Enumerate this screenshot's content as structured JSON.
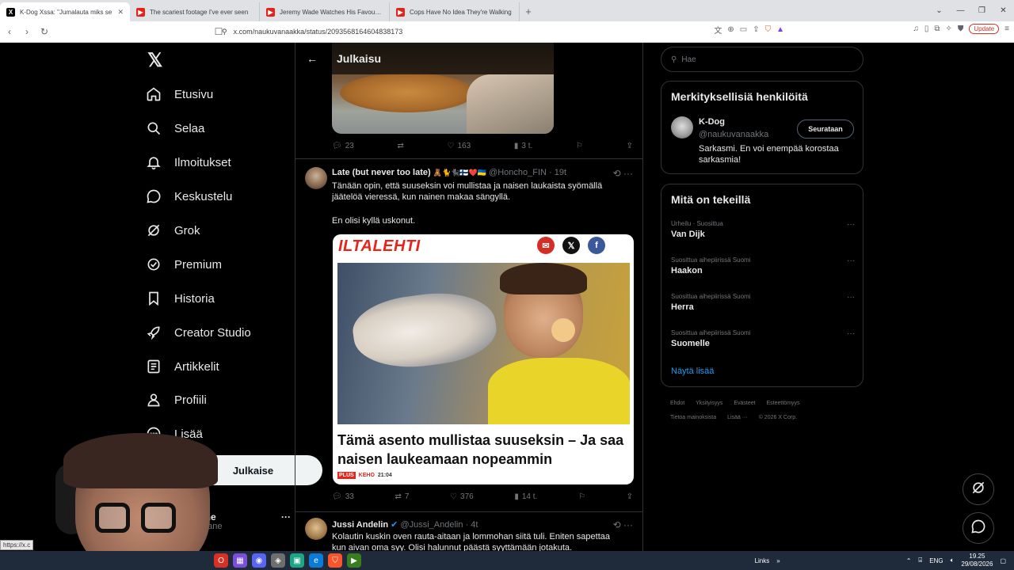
{
  "browser": {
    "tabs": [
      {
        "title": "K-Dog Xssa: \"Jumalauta miks se",
        "active": true,
        "favicon": "x-favicon"
      },
      {
        "title": "The scariest footage I've ever seen",
        "active": false,
        "favicon": "youtube-favicon"
      },
      {
        "title": "Jeremy Wade Watches His Favourite",
        "active": false,
        "favicon": "youtube-favicon"
      },
      {
        "title": "Cops Have No Idea They're Walking",
        "active": false,
        "favicon": "youtube-favicon"
      }
    ],
    "url": "x.com/naukuvanaakka/status/2093568164604838173",
    "update_label": "Update"
  },
  "nav": {
    "items": [
      {
        "label": "Etusivu",
        "icon": "home-icon"
      },
      {
        "label": "Selaa",
        "icon": "search-icon"
      },
      {
        "label": "Ilmoitukset",
        "icon": "bell-icon"
      },
      {
        "label": "Keskustelu",
        "icon": "chat-icon"
      },
      {
        "label": "Grok",
        "icon": "grok-icon"
      },
      {
        "label": "Premium",
        "icon": "verified-icon"
      },
      {
        "label": "Historia",
        "icon": "bookmark-icon"
      },
      {
        "label": "Creator Studio",
        "icon": "rocket-icon"
      },
      {
        "label": "Artikkelit",
        "icon": "article-icon"
      },
      {
        "label": "Profiili",
        "icon": "profile-icon"
      },
      {
        "label": "Lisää",
        "icon": "more-icon"
      }
    ],
    "post_button": "Julkaise",
    "account_name": "Mane",
    "account_handle": "…mane"
  },
  "center": {
    "header_title": "Julkaisu",
    "first_post_actions": {
      "replies": "23",
      "reposts": "",
      "likes": "163",
      "views": "3 t."
    },
    "post": {
      "name": "Late (but never too late)",
      "emoji": "🧸🐈🐈‍⬛🇫🇮❤️🇺🇦",
      "handle": "@Honcho_FIN",
      "time": "19t",
      "text1": "Tänään opin, että suuseksin voi mullistaa ja naisen laukaista syömällä jäätelöä vieressä, kun nainen makaa sängyllä.",
      "text2": "En olisi kyllä uskonut.",
      "card": {
        "brand": "ILTALEHTI",
        "headline": "Tämä asento mullistaa suuseksin – Ja saa naisen laukeamaan nopeammin",
        "plus": "PLUS",
        "section": "KEHO",
        "time": "21:04"
      },
      "actions": {
        "replies": "33",
        "reposts": "7",
        "likes": "376",
        "views": "14 t."
      }
    },
    "post2": {
      "name": "Jussi Andelin",
      "handle": "@Jussi_Andelin",
      "time": "4t",
      "text": "Kolautin kuskin oven rauta-aitaan ja lommohan siitä tuli. Eniten sapettaa kun aivan oma syy. Olisi halunnut päästä syyttämään jotakuta."
    }
  },
  "right": {
    "search_placeholder": "Hae",
    "people_title": "Merkityksellisiä henkilöitä",
    "person": {
      "name": "K-Dog",
      "handle": "@naukuvanaakka",
      "bio": "Sarkasmi. En voi enempää korostaa sarkasmia!",
      "follow_label": "Seurataan"
    },
    "trends_title": "Mitä on tekeillä",
    "trends": [
      {
        "context": "Urheilu · Suosittua",
        "title": "Van Dijk"
      },
      {
        "context": "Suosittua aihepiirissä Suomi",
        "title": "Haakon"
      },
      {
        "context": "Suosittua aihepiirissä Suomi",
        "title": "Herra"
      },
      {
        "context": "Suosittua aihepiirissä Suomi",
        "title": "Suomelle"
      }
    ],
    "show_more": "Näytä lisää",
    "footer": [
      "Ehdot",
      "Yksityisyys",
      "Evästeet",
      "Esteettömyys",
      "Tietoa mainoksista",
      "Lisää ···",
      "© 2026 X Corp."
    ]
  },
  "status_url": "https://x.c",
  "taskbar": {
    "links_label": "Links",
    "lang": "ENG",
    "time": "19.25",
    "date": "29/08/2026"
  }
}
